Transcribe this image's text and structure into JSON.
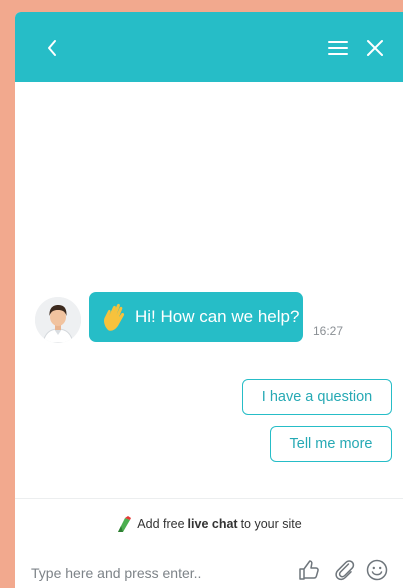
{
  "header": {
    "back_icon": "chevron-left-icon",
    "menu_icon": "hamburger-menu-icon",
    "close_icon": "close-icon",
    "background_color": "#26bdc7"
  },
  "conversation": {
    "agent_avatar_icon": "agent-avatar-icon",
    "greeting": {
      "emoji_icon": "waving-hand-icon",
      "text": "Hi! How can we help?",
      "time": "16:27"
    },
    "quick_replies": [
      {
        "label": "I have a question"
      },
      {
        "label": "Tell me more"
      }
    ]
  },
  "promo": {
    "prefix": "Add free",
    "bold": "live chat",
    "suffix": "to your site"
  },
  "composer": {
    "placeholder": "Type here and press enter..",
    "value": "",
    "tools": [
      "thumbs-up-icon",
      "paperclip-icon",
      "emoji-icon"
    ]
  },
  "colors": {
    "accent": "#26bdc7",
    "page_background": "#f2a98e"
  }
}
